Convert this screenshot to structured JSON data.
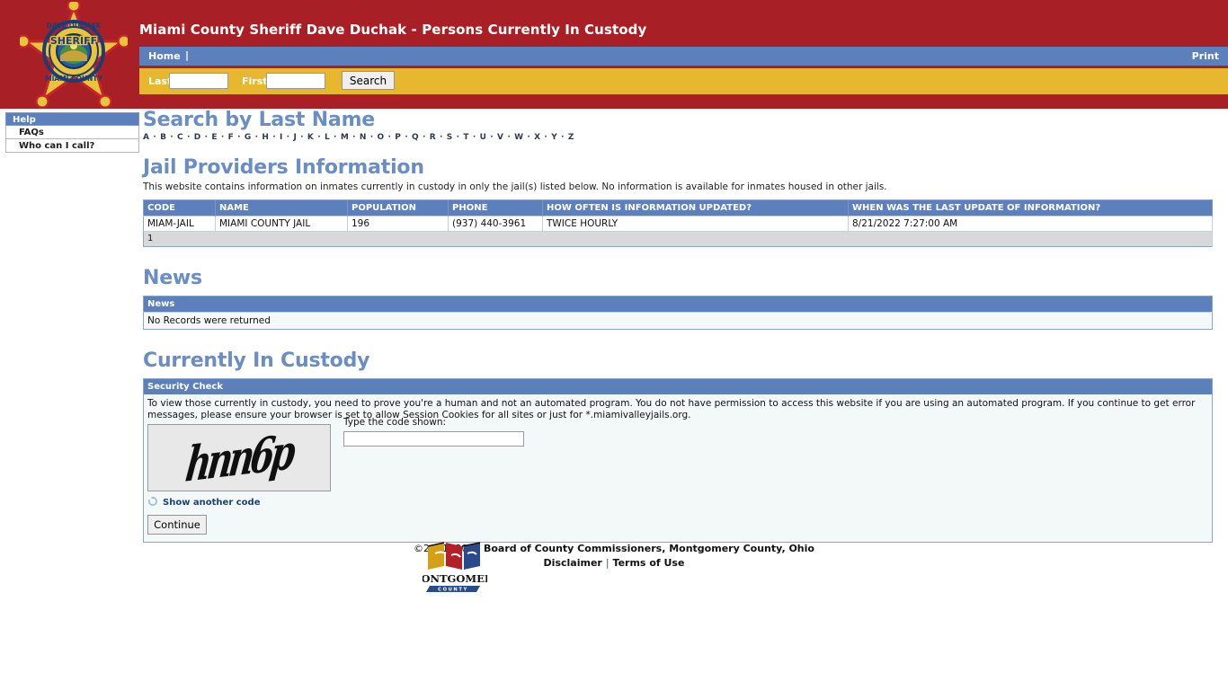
{
  "header": {
    "title": "Miami County Sheriff Dave Duchak - Persons Currently In Custody",
    "badge": {
      "top_text": "DAVE DUCHAK",
      "mid_text": "SHERIFF",
      "bottom_text": "MIAMI COUNTY"
    },
    "nav": {
      "home_label": "Home",
      "separator": "|",
      "print_label": "Print"
    },
    "search": {
      "last_label": "Last",
      "last_value": "",
      "first_label": "First",
      "first_value": "",
      "button_label": "Search"
    }
  },
  "sidebar": {
    "header": "Help",
    "items": [
      {
        "label": "FAQs"
      },
      {
        "label": "Who can I call?"
      }
    ]
  },
  "search_by_last_name": {
    "heading": "Search by Last Name",
    "letters": [
      "A",
      "B",
      "C",
      "D",
      "E",
      "F",
      "G",
      "H",
      "I",
      "J",
      "K",
      "L",
      "M",
      "N",
      "O",
      "P",
      "Q",
      "R",
      "S",
      "T",
      "U",
      "V",
      "W",
      "X",
      "Y",
      "Z"
    ],
    "separator": "·"
  },
  "jail_providers": {
    "heading": "Jail Providers Information",
    "description": "This website contains information on inmates currently in custody in only the jail(s) listed below. No information is available for inmates housed in other jails.",
    "columns": [
      "CODE",
      "NAME",
      "POPULATION",
      "PHONE",
      "HOW OFTEN IS INFORMATION UPDATED?",
      "WHEN WAS THE LAST UPDATE OF INFORMATION?"
    ],
    "rows": [
      [
        "MIAM-JAIL",
        "MIAMI COUNTY JAIL",
        "196",
        "(937) 440-3961",
        "TWICE HOURLY",
        "8/21/2022 7:27:00 AM"
      ]
    ],
    "pager": "1"
  },
  "news": {
    "heading": "News",
    "column": "News",
    "empty_message": "No Records were returned"
  },
  "custody": {
    "heading": "Currently In Custody",
    "security_header": "Security Check",
    "instructions": "To view those currently in custody, you need to prove you're a human and not an automated program. You do not have permission to access this website if you are using an automated program. If you continue to get error messages, please ensure your browser is set to allow Session Cookies for all sites or just for *.miamivalleyjails.org.",
    "captcha_code": "hnn6p",
    "code_label": "Type the code shown:",
    "code_value": "",
    "refresh_label": "Show another code",
    "continue_label": "Continue"
  },
  "footer": {
    "copyright_prefix": "©2001- 2022 ",
    "copyright_bold": "Board of County Commissioners, Montgomery County, Ohio",
    "disclaimer_label": "Disclaimer",
    "link_separator": "|",
    "terms_label": "Terms of Use",
    "logo_name": "MONTGOMERY",
    "logo_sub": "C O U N T Y"
  },
  "colors": {
    "header_red": "#a82025",
    "nav_blue": "#5b80bc",
    "search_gold": "#e8b730",
    "heading_blue": "#6a8ec4",
    "panel_bg": "#f2f9f8"
  }
}
